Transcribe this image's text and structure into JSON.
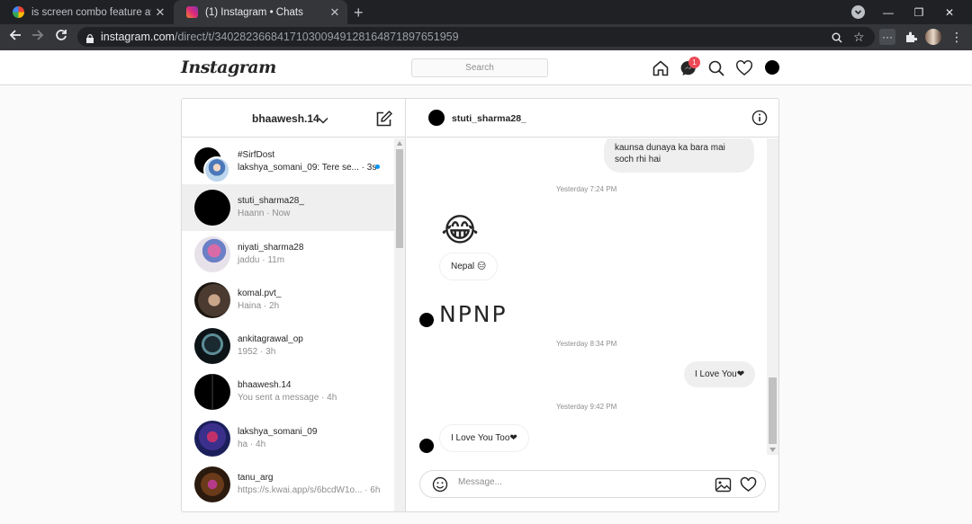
{
  "browser": {
    "tabs": [
      {
        "title": "is screen combo feature available",
        "close": "✕",
        "active": false
      },
      {
        "title": "(1) Instagram • Chats",
        "close": "✕",
        "active": true
      }
    ],
    "new_tab": "+",
    "url_host": "instagram.com",
    "url_path": "/direct/t/340282366841710300949128164871897651959"
  },
  "header": {
    "logo": "Instagram",
    "search_placeholder": "Search",
    "notification_count": "1"
  },
  "inbox": {
    "account": "bhaawesh.14",
    "threads": [
      {
        "name": "#SirfDost",
        "preview": "lakshya_somani_09: Tere se... · 3s",
        "unread": true
      },
      {
        "name": "stuti_sharma28_",
        "preview": "Haann · Now",
        "selected": true
      },
      {
        "name": "niyati_sharma28",
        "preview": "jaddu · 11m"
      },
      {
        "name": "komal.pvt_",
        "preview": "Haina · 2h"
      },
      {
        "name": "ankitagrawal_op",
        "preview": "1952 · 3h"
      },
      {
        "name": "bhaawesh.14",
        "preview": "You sent a message · 4h"
      },
      {
        "name": "lakshya_somani_09",
        "preview": "ha · 4h"
      },
      {
        "name": "tanu_arg",
        "preview": "https://s.kwai.app/s/6bcdW1o... · 6h"
      }
    ]
  },
  "chat": {
    "recipient": "stuti_sharma28_",
    "messages": {
      "m1": "kaunsa dunaya ka bara mai soch rhi hai",
      "t1": "Yesterday 7:24 PM",
      "emoji": "😂",
      "m2": "Nepal 😑",
      "m3": "NPNP",
      "t2": "Yesterday 8:34 PM",
      "m4": "I Love You❤",
      "t3": "Yesterday 9:42 PM",
      "m5": "I Love You Too❤"
    },
    "composer_placeholder": "Message..."
  },
  "colors": {
    "unread_dot": "#0095f6",
    "badge": "#ed4956",
    "chrome_dark": "#202124"
  }
}
